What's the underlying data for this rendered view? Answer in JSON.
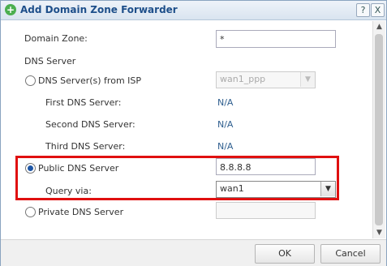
{
  "dialog": {
    "title": "Add Domain Zone Forwarder",
    "help_button": "?",
    "close_button": "X"
  },
  "form": {
    "domain_zone_label": "Domain Zone:",
    "domain_zone_value": "*",
    "dns_server_heading": "DNS Server",
    "isp_option_label": "DNS Server(s) from ISP",
    "isp_select_value": "wan1_ppp",
    "first_dns_label": "First DNS Server:",
    "first_dns_value": "N/A",
    "second_dns_label": "Second DNS Server:",
    "second_dns_value": "N/A",
    "third_dns_label": "Third DNS Server:",
    "third_dns_value": "N/A",
    "public_option_label": "Public DNS Server",
    "public_dns_value": "8.8.8.8",
    "query_via_label": "Query via:",
    "query_via_value": "wan1",
    "private_option_label": "Private DNS Server",
    "private_dns_value": ""
  },
  "footer": {
    "ok_label": "OK",
    "cancel_label": "Cancel"
  },
  "colors": {
    "highlight": "#e01010",
    "title": "#1e4f8a",
    "value": "#2f5f8f"
  }
}
